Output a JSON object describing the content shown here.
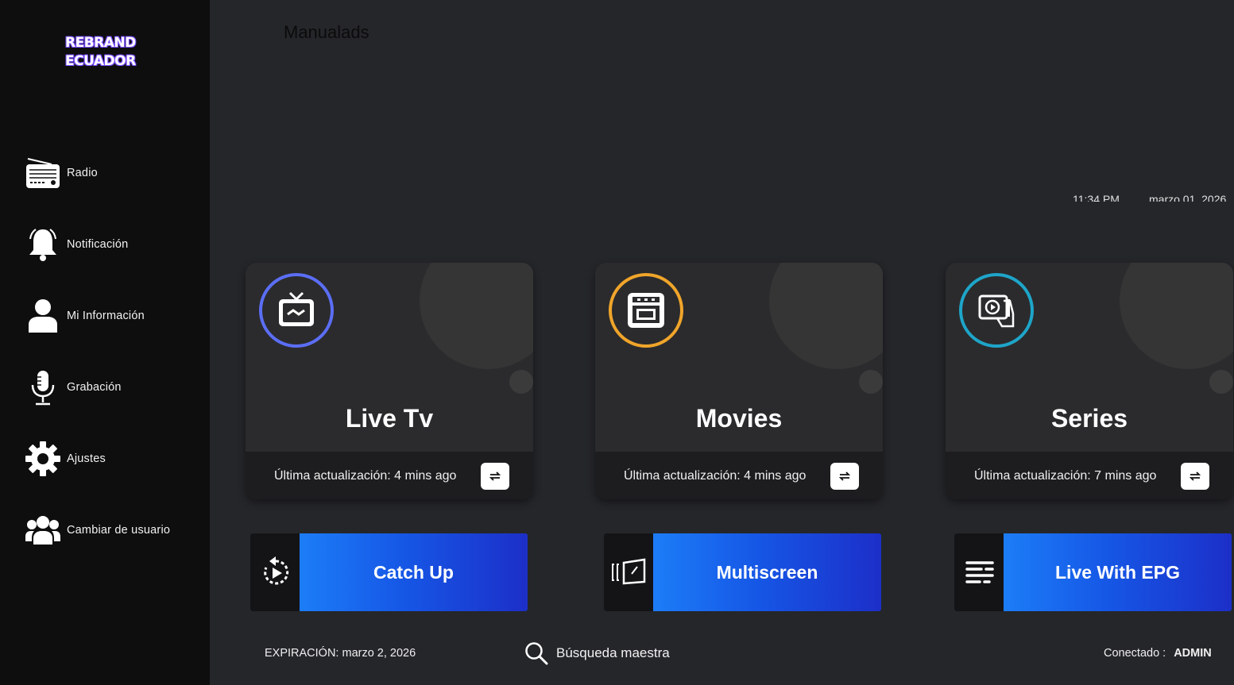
{
  "brand": {
    "line1": "REBRAND",
    "line2": "ECUADOR"
  },
  "header": {
    "app_title": "Manualads",
    "time": "11:34 PM",
    "date": "marzo 01, 2026"
  },
  "sidebar": {
    "items": [
      {
        "label": "Radio",
        "icon": "radio-icon"
      },
      {
        "label": "Notificación",
        "icon": "bell-icon"
      },
      {
        "label": "Mi Información",
        "icon": "user-icon"
      },
      {
        "label": "Grabación",
        "icon": "microphone-icon"
      },
      {
        "label": "Ajustes",
        "icon": "gear-icon"
      },
      {
        "label": "Cambiar de usuario",
        "icon": "users-icon"
      }
    ]
  },
  "cards": [
    {
      "title": "Live Tv",
      "update": "Última actualización: 4 mins ago",
      "icon": "tv-icon",
      "ring_color": "#5b6ef5"
    },
    {
      "title": "Movies",
      "update": "Última actualización: 4 mins ago",
      "icon": "cinema-icon",
      "ring_color": "#f0a52a"
    },
    {
      "title": "Series",
      "update": "Última actualización: 7 mins ago",
      "icon": "series-play-icon",
      "ring_color": "#1ea5c9"
    }
  ],
  "actions": [
    {
      "label": "Catch Up",
      "icon": "replay-icon"
    },
    {
      "label": "Multiscreen",
      "icon": "multiscreen-icon"
    },
    {
      "label": "Live With EPG",
      "icon": "epg-list-icon"
    }
  ],
  "footer": {
    "expiry": "EXPIRACIÓN: marzo 2, 2026",
    "search_label": "Búsqueda maestra",
    "connected_label": "Conectado :",
    "connected_user": "ADMIN"
  }
}
